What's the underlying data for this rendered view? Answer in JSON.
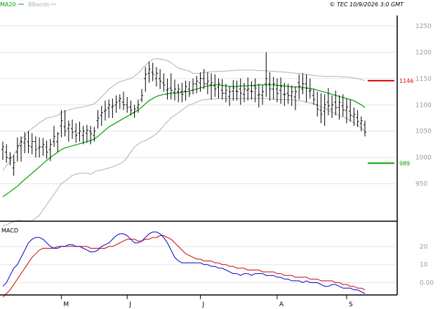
{
  "header": {
    "legend_ma20": "MA20",
    "legend_bbands": "BBands",
    "copyright": "© TEC 10/9/2026 3:0 GMT"
  },
  "colors": {
    "background": "#ffffff",
    "band_fill": "#ffffff",
    "grid": "#e5e5e5",
    "price_bar": "#000000",
    "ma20": "#00a000",
    "bbands": "#b0b0b0",
    "macd": "#0000cc",
    "signal": "#cc0000",
    "resistance": "#dd0000",
    "support": "#00a000",
    "axis_text": "#999999"
  },
  "chart_data": [
    {
      "type": "line",
      "title": "",
      "xlabel": "",
      "ylabel": "",
      "ylim": [
        880,
        1270
      ],
      "ytick_values": [
        950,
        1000,
        1050,
        1100,
        1150,
        1200,
        1250
      ],
      "ytick_labels": [
        "950",
        "1000",
        "1050",
        "1100",
        "1150",
        "1200",
        "1250"
      ],
      "x_count": 100,
      "month_ticks": [
        {
          "label": "M",
          "index": 16
        },
        {
          "label": "J",
          "index": 34
        },
        {
          "label": "J",
          "index": 54
        },
        {
          "label": "A",
          "index": 75
        },
        {
          "label": "S",
          "index": 94
        }
      ],
      "ohlc": {
        "highs": [
          1030,
          1025,
          1010,
          1005,
          1038,
          1040,
          1048,
          1050,
          1046,
          1040,
          1038,
          1037,
          1032,
          1035,
          1060,
          1048,
          1090,
          1090,
          1070,
          1072,
          1065,
          1068,
          1060,
          1062,
          1060,
          1058,
          1090,
          1098,
          1108,
          1110,
          1112,
          1118,
          1120,
          1125,
          1115,
          1108,
          1100,
          1110,
          1130,
          1172,
          1182,
          1180,
          1172,
          1168,
          1160,
          1150,
          1160,
          1148,
          1140,
          1142,
          1146,
          1145,
          1150,
          1155,
          1162,
          1168,
          1162,
          1160,
          1158,
          1150,
          1149,
          1140,
          1135,
          1147,
          1146,
          1150,
          1142,
          1152,
          1145,
          1150,
          1140,
          1138,
          1200,
          1162,
          1153,
          1150,
          1152,
          1142,
          1140,
          1137,
          1135,
          1158,
          1160,
          1158,
          1150,
          1130,
          1125,
          1122,
          1120,
          1132,
          1118,
          1127,
          1118,
          1120,
          1112,
          1110,
          1095,
          1090,
          1078,
          1070
        ],
        "lows": [
          995,
          990,
          985,
          965,
          992,
          992,
          1008,
          1008,
          1006,
          1000,
          1000,
          1003,
          997,
          993,
          1020,
          1010,
          1038,
          1040,
          1030,
          1035,
          1028,
          1030,
          1025,
          1028,
          1025,
          1030,
          1055,
          1060,
          1070,
          1075,
          1075,
          1085,
          1092,
          1090,
          1085,
          1080,
          1075,
          1085,
          1105,
          1125,
          1142,
          1145,
          1135,
          1130,
          1125,
          1110,
          1110,
          1108,
          1105,
          1105,
          1108,
          1115,
          1120,
          1122,
          1125,
          1130,
          1120,
          1110,
          1115,
          1112,
          1110,
          1105,
          1098,
          1108,
          1108,
          1100,
          1105,
          1108,
          1110,
          1105,
          1095,
          1100,
          1115,
          1108,
          1110,
          1105,
          1102,
          1098,
          1102,
          1098,
          1090,
          1110,
          1120,
          1105,
          1112,
          1100,
          1078,
          1065,
          1060,
          1080,
          1075,
          1080,
          1072,
          1078,
          1065,
          1068,
          1060,
          1058,
          1050,
          1040
        ],
        "opens": [
          1015,
          1010,
          998,
          980,
          1010,
          1022,
          1028,
          1030,
          1020,
          1030,
          1018,
          1020,
          1020,
          1015,
          1030,
          1030,
          1060,
          1058,
          1055,
          1055,
          1050,
          1046,
          1042,
          1046,
          1050,
          1042,
          1070,
          1080,
          1088,
          1094,
          1096,
          1100,
          1108,
          1105,
          1100,
          1096,
          1085,
          1095,
          1110,
          1150,
          1160,
          1162,
          1150,
          1150,
          1142,
          1128,
          1132,
          1124,
          1125,
          1125,
          1126,
          1130,
          1128,
          1140,
          1142,
          1150,
          1140,
          1138,
          1136,
          1134,
          1128,
          1122,
          1116,
          1126,
          1126,
          1130,
          1120,
          1128,
          1126,
          1136,
          1118,
          1118,
          1140,
          1140,
          1130,
          1130,
          1128,
          1120,
          1122,
          1117,
          1115,
          1142,
          1130,
          1140,
          1126,
          1118,
          1100,
          1090,
          1088,
          1105,
          1092,
          1105,
          1095,
          1098,
          1090,
          1088,
          1078,
          1076,
          1065,
          1062
        ],
        "closes": [
          1020,
          1000,
          1000,
          990,
          1022,
          1030,
          1035,
          1022,
          1030,
          1015,
          1020,
          1025,
          1010,
          1025,
          1040,
          1045,
          1070,
          1050,
          1062,
          1048,
          1042,
          1050,
          1050,
          1052,
          1045,
          1050,
          1075,
          1085,
          1090,
          1100,
          1098,
          1105,
          1112,
          1100,
          1095,
          1090,
          1092,
          1100,
          1118,
          1158,
          1168,
          1158,
          1160,
          1145,
          1138,
          1130,
          1128,
          1130,
          1130,
          1120,
          1135,
          1122,
          1140,
          1145,
          1150,
          1140,
          1145,
          1142,
          1130,
          1140,
          1122,
          1128,
          1125,
          1132,
          1125,
          1122,
          1130,
          1130,
          1125,
          1132,
          1120,
          1125,
          1150,
          1130,
          1140,
          1122,
          1135,
          1120,
          1118,
          1125,
          1125,
          1135,
          1140,
          1132,
          1128,
          1110,
          1092,
          1082,
          1100,
          1098,
          1100,
          1095,
          1105,
          1090,
          1096,
          1080,
          1082,
          1068,
          1070,
          1048
        ]
      },
      "series": [
        {
          "name": "MA20",
          "values": [
            925,
            930,
            935,
            940,
            945,
            952,
            958,
            964,
            970,
            976,
            982,
            988,
            994,
            1000,
            1005,
            1010,
            1015,
            1018,
            1020,
            1022,
            1024,
            1026,
            1028,
            1030,
            1032,
            1035,
            1040,
            1046,
            1052,
            1058,
            1062,
            1066,
            1070,
            1074,
            1078,
            1082,
            1086,
            1090,
            1096,
            1102,
            1108,
            1112,
            1116,
            1118,
            1120,
            1121,
            1122,
            1122,
            1123,
            1124,
            1125,
            1126,
            1128,
            1130,
            1132,
            1134,
            1136,
            1137,
            1138,
            1138,
            1137,
            1136,
            1135,
            1135,
            1135,
            1136,
            1136,
            1136,
            1137,
            1137,
            1138,
            1138,
            1138,
            1138,
            1138,
            1137,
            1137,
            1136,
            1135,
            1134,
            1134,
            1134,
            1133,
            1132,
            1131,
            1130,
            1128,
            1126,
            1124,
            1122,
            1120,
            1118,
            1116,
            1114,
            1112,
            1110,
            1108,
            1104,
            1100,
            1095
          ]
        },
        {
          "name": "BBands",
          "values": [
            975,
            985,
            992,
            1005,
            1015,
            1035,
            1040,
            1050,
            1055,
            1060,
            1066,
            1070,
            1075,
            1076,
            1078,
            1080,
            1085,
            1088,
            1090,
            1092,
            1094,
            1095,
            1096,
            1098,
            1100,
            1102,
            1108,
            1115,
            1122,
            1130,
            1135,
            1140,
            1144,
            1146,
            1148,
            1150,
            1155,
            1160,
            1168,
            1175,
            1182,
            1186,
            1188,
            1187,
            1186,
            1184,
            1180,
            1175,
            1170,
            1168,
            1166,
            1164,
            1160,
            1160,
            1160,
            1162,
            1162,
            1163,
            1163,
            1164,
            1164,
            1164,
            1165,
            1165,
            1166,
            1166,
            1166,
            1166,
            1166,
            1166,
            1165,
            1165,
            1165,
            1164,
            1164,
            1163,
            1163,
            1162,
            1162,
            1161,
            1160,
            1160,
            1159,
            1158,
            1157,
            1156,
            1155,
            1155,
            1154,
            1154,
            1154,
            1154,
            1154,
            1153,
            1153,
            1152,
            1151,
            1150,
            1148,
            1146
          ]
        },
        {
          "name": "BBands lower",
          "values": [
            870,
            872,
            875,
            878,
            880,
            880,
            878,
            878,
            880,
            885,
            890,
            900,
            910,
            920,
            930,
            940,
            950,
            955,
            960,
            966,
            968,
            970,
            970,
            970,
            968,
            972,
            975,
            976,
            978,
            980,
            982,
            985,
            988,
            992,
            1000,
            1010,
            1020,
            1025,
            1030,
            1032,
            1036,
            1040,
            1045,
            1052,
            1060,
            1068,
            1075,
            1080,
            1085,
            1090,
            1095,
            1100,
            1102,
            1105,
            1108,
            1110,
            1110,
            1111,
            1111,
            1112,
            1112,
            1112,
            1112,
            1112,
            1112,
            1112,
            1112,
            1112,
            1112,
            1112,
            1113,
            1112,
            1112,
            1111,
            1111,
            1110,
            1110,
            1110,
            1110,
            1110,
            1108,
            1108,
            1107,
            1105,
            1104,
            1102,
            1100,
            1096,
            1094,
            1090,
            1086,
            1083,
            1080,
            1077,
            1074,
            1070,
            1066,
            1062,
            1056,
            1050
          ]
        }
      ],
      "levels": [
        {
          "label": "1146",
          "value": 1146,
          "role": "resistance"
        },
        {
          "label": "989",
          "value": 989,
          "role": "support"
        }
      ],
      "legend_placement": "top-left",
      "grid": true
    },
    {
      "type": "line",
      "title": "MACD",
      "ylim": [
        -6,
        32
      ],
      "ytick_values": [
        20,
        10,
        0
      ],
      "ytick_labels": [
        "20",
        "10",
        "0.00"
      ],
      "series": [
        {
          "name": "MACD",
          "values": [
            -2,
            0,
            4,
            8,
            10,
            14,
            18,
            22,
            24,
            25,
            25,
            24,
            22,
            20,
            19,
            19,
            20,
            20,
            21,
            21,
            20,
            20,
            19,
            18,
            17,
            17,
            18,
            20,
            21,
            22,
            24,
            26,
            27,
            27,
            26,
            24,
            22,
            22,
            23,
            25,
            27,
            28,
            28,
            27,
            25,
            22,
            18,
            14,
            12,
            11,
            11,
            11,
            11,
            11,
            11,
            10,
            10,
            9,
            9,
            8,
            8,
            7,
            6,
            5,
            5,
            4,
            5,
            5,
            4,
            5,
            5,
            5,
            4,
            4,
            4,
            3,
            3,
            2,
            2,
            1,
            1,
            1,
            0,
            1,
            0,
            0,
            0,
            -1,
            -2,
            -2,
            -1,
            -1,
            -2,
            -3,
            -3,
            -3,
            -4,
            -4,
            -5,
            -6
          ]
        },
        {
          "name": "Signal",
          "values": [
            -8,
            -6,
            -4,
            -1,
            2,
            5,
            8,
            11,
            14,
            16,
            18,
            19,
            19,
            19,
            19,
            20,
            20,
            20,
            20,
            20,
            20,
            20,
            20,
            20,
            19,
            19,
            19,
            19,
            19,
            20,
            20,
            21,
            22,
            23,
            24,
            24,
            24,
            23,
            23,
            24,
            24,
            25,
            25,
            26,
            26,
            25,
            24,
            22,
            20,
            18,
            16,
            15,
            14,
            13,
            13,
            12,
            12,
            12,
            11,
            11,
            10,
            10,
            9,
            9,
            8,
            8,
            8,
            7,
            7,
            7,
            7,
            6,
            6,
            6,
            6,
            5,
            5,
            4,
            4,
            4,
            3,
            3,
            3,
            3,
            2,
            2,
            2,
            1,
            1,
            1,
            1,
            0,
            0,
            -1,
            -1,
            -2,
            -2,
            -3,
            -3,
            -4
          ]
        }
      ],
      "grid": true
    }
  ]
}
